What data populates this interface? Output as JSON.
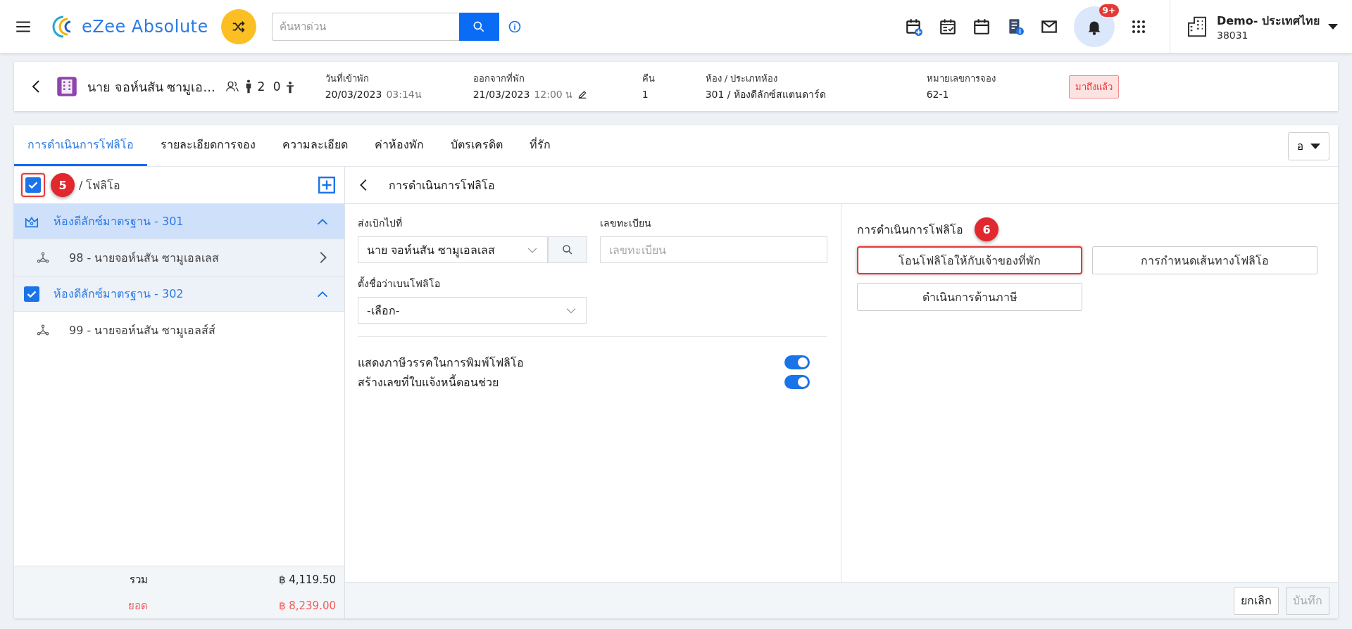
{
  "topbar": {
    "brand": "eZee Absolute",
    "search": {
      "placeholder": "ค้นหาด่วน"
    },
    "notification_badge": "9+",
    "property": {
      "name": "Demo- ประเทศไทย",
      "code": "38031"
    }
  },
  "booking": {
    "guest_name": "นาย จอห์นสัน ซามูเอ...",
    "adults": "2",
    "children": "0",
    "status": "มาถึงแล้ว",
    "fields": [
      {
        "label": "วันที่เข้าพัก",
        "value": "20/03/2023",
        "time": "03:14น",
        "editable": false
      },
      {
        "label": "ออกจากที่พัก",
        "value": "21/03/2023",
        "time": "12:00 น",
        "editable": true
      },
      {
        "label": "คืน",
        "value": "1"
      },
      {
        "label": "ห้อง / ประเภทห้อง",
        "value": "301 / ห้องดีลักซ์สแตนดาร์ด"
      },
      {
        "label": "หมายเลขการจอง",
        "value": "62-1"
      }
    ]
  },
  "tabs": [
    {
      "label": "การดำเนินการโฟลิโอ",
      "selected": true
    },
    {
      "label": "รายละเอียดการจอง",
      "selected": false
    },
    {
      "label": "ความละเอียด",
      "selected": false
    },
    {
      "label": "ค่าห้องพัก",
      "selected": false
    },
    {
      "label": "บัตรเครดิต",
      "selected": false
    },
    {
      "label": "ที่รัก",
      "selected": false
    }
  ],
  "tab_menu": "อ",
  "folio_list": {
    "label": "/ โฟลิโอ",
    "checked": true,
    "highlighted": true,
    "step": "5",
    "groups": [
      {
        "title": "ห้องดีลักซ์มาตรฐาน - 301",
        "kind": "master",
        "selected": true,
        "expanded": true,
        "children": [
          {
            "label": "98 - นายจอห์นสัน ซามูเอลเลส",
            "selected": true
          }
        ]
      },
      {
        "title": "ห้องดีลักซ์มาตรฐาน - 302",
        "kind": "checkbox",
        "checked": true,
        "selected": false,
        "expanded": true,
        "children": [
          {
            "label": "99 - นายจอห์นสัน ซามูเอลส์ส์",
            "selected": false
          }
        ]
      }
    ]
  },
  "totals": [
    {
      "label": "รวม",
      "value": "฿ 4,119.50",
      "kind": "total"
    },
    {
      "label": "ยอด",
      "value": "฿ 8,239.00",
      "kind": "balance"
    }
  ],
  "folio_operations": {
    "title": "การดำเนินการโฟลิโอ",
    "send_to": {
      "label": "ส่งเบิกไปที่",
      "value": "นาย จอห์นสัน ซามูเอลเลส"
    },
    "registration": {
      "label": "เลขทะเบียน",
      "placeholder": "เลขทะเบียน"
    },
    "folio_name": {
      "label": "ตั้งชื่อว่าเบนโฟลิโอ",
      "value": "-เลือก-"
    },
    "toggles": [
      {
        "label": "แสดงภาษีวรรคในการพิมพ์โฟลิโอ",
        "on": true
      },
      {
        "label": "สร้างเลขที่ใบแจ้งหนี้ตอนช่วย",
        "on": true
      }
    ]
  },
  "actions": {
    "title": "การดำเนินการโฟลิโอ",
    "step": "6",
    "buttons": [
      {
        "label": "โอนโฟลิโอให้กับเจ้าของที่พัก",
        "highlighted": true
      },
      {
        "label": "การกำหนดเส้นทางโฟลิโอ",
        "highlighted": false
      },
      {
        "label": "ดำเนินการด้านภาษี",
        "highlighted": false
      }
    ]
  },
  "footer_buttons": [
    {
      "label": "ยกเลิก",
      "disabled": false
    },
    {
      "label": "บันทึก",
      "disabled": true
    }
  ]
}
